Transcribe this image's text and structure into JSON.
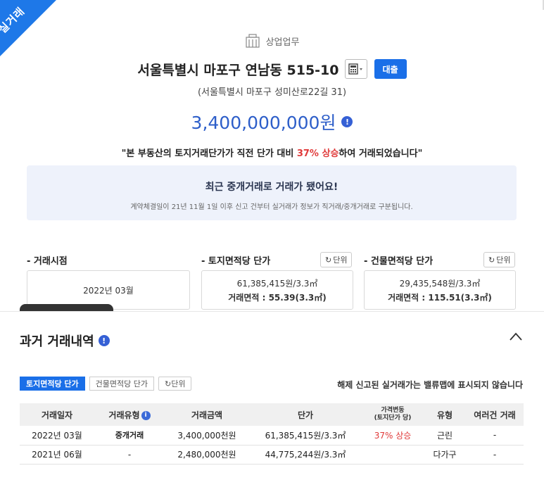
{
  "ribbon": "실거래",
  "category": "상업업무",
  "title": "서울특별시 마포구 연남동 515-10",
  "loan_label": "대출",
  "road_address": "(서울특별시 마포구 성미산로22길 31)",
  "price": "3,400,000,000원",
  "quote_pre": "\"본 부동산의 토지거래단가가 직전 단가 대비 ",
  "quote_hl": "37% 상승",
  "quote_post": "하여 거래되었습니다\"",
  "notice": {
    "title": "최근 중개거래로 거래가 됐어요!",
    "sub": "계약체결일이 21년 11월 1일 이후 신고 건부터 실거래가 정보가 직거래/중개거래로 구분됩니다."
  },
  "stats": {
    "deal_label": "- 거래시점",
    "deal_value": "2022년 03월",
    "land_label": "- 토지면적당 단가",
    "land_line1": "61,385,415원/3.3㎡",
    "land_line2": "거래면적 : 55.39(3.3㎡)",
    "bldg_label": "- 건물면적당 단가",
    "bldg_line1": "29,435,548원/3.3㎡",
    "bldg_line2": "거래면적 : 115.51(3.3㎡)",
    "unit_label": "단위"
  },
  "history": {
    "title": "과거 거래내역",
    "tab_land": "토지면적당 단가",
    "tab_bldg": "건물면적당 단가",
    "unit_label": "단위",
    "note": "해제 신고된 실거래가는 밸류맵에 표시되지 않습니다",
    "headers": [
      "거래일자",
      "거래유형",
      "거래금액",
      "단가",
      "가격변동",
      "(토지단가 당)",
      "유형",
      "여러건 거래"
    ],
    "rows": [
      [
        "2022년 03월",
        "중개거래",
        "3,400,000천원",
        "61,385,415원/3.3㎡",
        "37% 상승",
        "근린",
        "-"
      ],
      [
        "2021년 06월",
        "-",
        "2,480,000천원",
        "44,775,244원/3.3㎡",
        "",
        "다가구",
        "-"
      ]
    ]
  },
  "colors": {
    "accent": "#1a6fe8",
    "price": "#2d5ec9",
    "up": "#e03a3a",
    "notice_bg": "#eef2fb"
  }
}
